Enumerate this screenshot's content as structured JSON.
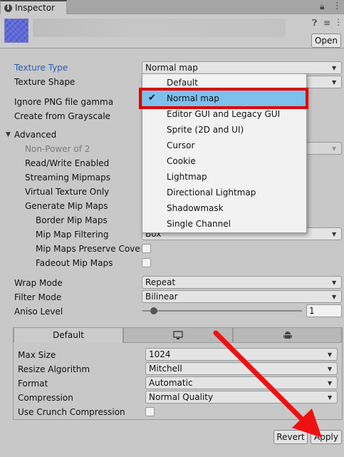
{
  "window": {
    "tab_label": "Inspector"
  },
  "header": {
    "open_label": "Open"
  },
  "properties": {
    "texture_type": {
      "label": "Texture Type",
      "value": "Normal map"
    },
    "texture_shape": {
      "label": "Texture Shape"
    },
    "ignore_png": {
      "label": "Ignore PNG file gamma"
    },
    "from_grayscale": {
      "label": "Create from Grayscale"
    },
    "advanced": {
      "label": "Advanced"
    },
    "non_power_of_2": {
      "label": "Non-Power of 2"
    },
    "read_write": {
      "label": "Read/Write Enabled"
    },
    "streaming_mipmaps": {
      "label": "Streaming Mipmaps"
    },
    "virtual_texture": {
      "label": "Virtual Texture Only"
    },
    "generate_mipmaps": {
      "label": "Generate Mip Maps"
    },
    "border_mipmaps": {
      "label": "Border Mip Maps"
    },
    "mipmap_filtering": {
      "label": "Mip Map Filtering",
      "value": "Box"
    },
    "preserve_coverage": {
      "label": "Mip Maps Preserve Covera"
    },
    "fadeout_mipmaps": {
      "label": "Fadeout Mip Maps"
    },
    "wrap_mode": {
      "label": "Wrap Mode",
      "value": "Repeat"
    },
    "filter_mode": {
      "label": "Filter Mode",
      "value": "Bilinear"
    },
    "aniso_level": {
      "label": "Aniso Level",
      "value": "1",
      "slider_fraction": 0.07
    }
  },
  "platform": {
    "tabs": [
      {
        "label": "Default",
        "icon": ""
      },
      {
        "label": "",
        "icon": "monitor-icon"
      },
      {
        "label": "",
        "icon": "android-icon"
      }
    ],
    "max_size": {
      "label": "Max Size",
      "value": "1024"
    },
    "resize_algorithm": {
      "label": "Resize Algorithm",
      "value": "Mitchell"
    },
    "format": {
      "label": "Format",
      "value": "Automatic"
    },
    "compression": {
      "label": "Compression",
      "value": "Normal Quality"
    },
    "crunch": {
      "label": "Use Crunch Compression"
    }
  },
  "footer": {
    "revert_label": "Revert",
    "apply_label": "Apply"
  },
  "popup": {
    "selected": "Normal map",
    "items": [
      "Default",
      "Normal map",
      "Editor GUI and Legacy GUI",
      "Sprite (2D and UI)",
      "Cursor",
      "Cookie",
      "Lightmap",
      "Directional Lightmap",
      "Shadowmask",
      "Single Channel"
    ]
  },
  "colors": {
    "highlight": "#e00000",
    "arrow": "#ee1111",
    "selection": "#7dc0ee",
    "link_label": "#2b5cb0"
  }
}
